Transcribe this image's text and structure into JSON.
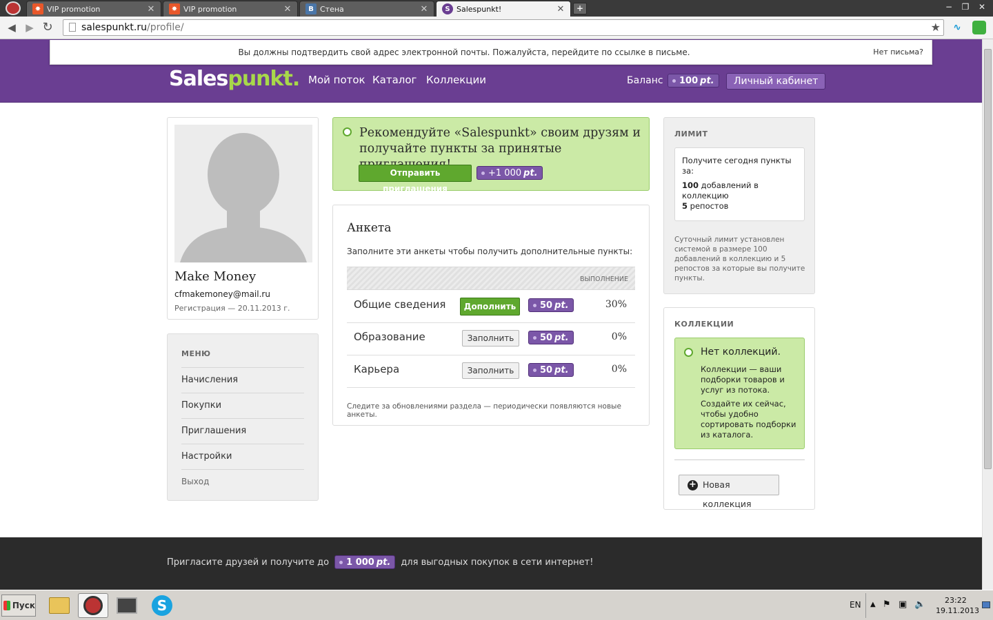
{
  "browser": {
    "tabs": [
      {
        "title": "VIP promotion",
        "favicon": "flame-icon",
        "active": false
      },
      {
        "title": "VIP promotion",
        "favicon": "flame-icon",
        "active": false
      },
      {
        "title": "Стена",
        "favicon": "vk-icon",
        "favicon_text": "В",
        "active": false
      },
      {
        "title": "Salespunkt!",
        "favicon": "salespunkt-icon",
        "active": true
      }
    ],
    "new_tab_label": "+",
    "url_host": "salespunkt.ru",
    "url_path": "/profile/",
    "win_controls": {
      "minimize": "−",
      "maximize": "❐",
      "close": "✕"
    }
  },
  "notice": {
    "message": "Вы должны подтвердить свой адрес электронной почты. Пожалуйста, перейдите по ссылке в письме.",
    "no_mail_link": "Нет письма?"
  },
  "header": {
    "logo_part1": "Sales",
    "logo_part2": "punkt.",
    "nav": [
      "Мой поток",
      "Каталог",
      "Коллекции"
    ],
    "balance_label": "Баланс",
    "balance_value": "100",
    "balance_unit": "pt.",
    "cabinet_button": "Личный кабинет"
  },
  "profile": {
    "name": "Make Money",
    "email": "cfmakemoney@mail.ru",
    "registration": "Регистрация — 20.11.2013 г."
  },
  "menu": {
    "title": "МЕНЮ",
    "items": [
      "Начисления",
      "Покупки",
      "Приглашения",
      "Настройки"
    ],
    "logout": "Выход"
  },
  "invite_banner": {
    "text": "Рекомендуйте «Salespunkt» своим друзям и получайте пункты за принятые приглашения!",
    "button": "Отправить приглашения",
    "badge_value": "+1 000",
    "badge_unit": "pt."
  },
  "survey": {
    "title": "Анкета",
    "subtitle": "Заполните эти анкеты чтобы получить дополнительные пункты:",
    "column_header": "ВЫПОЛНЕНИЕ",
    "rows": [
      {
        "name": "Общие сведения",
        "button": "Дополнить",
        "primary": true,
        "points": "50",
        "unit": "pt.",
        "progress": "30%"
      },
      {
        "name": "Образование",
        "button": "Заполнить",
        "primary": false,
        "points": "50",
        "unit": "pt.",
        "progress": "0%"
      },
      {
        "name": "Карьера",
        "button": "Заполнить",
        "primary": false,
        "points": "50",
        "unit": "pt.",
        "progress": "0%"
      }
    ],
    "footnote": "Следите за обновлениями раздела — периодически появляются новые анкеты."
  },
  "limit": {
    "title": "ЛИМИТ",
    "intro": "Получите сегодня пункты за:",
    "line1_num": "100",
    "line1_text": " добавлений в коллекцию",
    "line2_num": "5",
    "line2_text": " репостов",
    "description": "Суточный лимит установлен системой в размере 100 добавлений в коллекцию и 5 репостов за которые вы получите пункты."
  },
  "collections": {
    "title": "КОЛЛЕКЦИИ",
    "empty_title": "Нет коллекций.",
    "empty_text1": "Коллекции — ваши подборки товаров и услуг из потока.",
    "empty_text2": "Создайте их сейчас, чтобы удобно сортировать подборки из каталога.",
    "new_button": "Новая коллекция"
  },
  "footer": {
    "text_before": "Пригласите друзей и получите до",
    "badge_value": "1 000",
    "badge_unit": "pt.",
    "text_after": "для выгодных покупок в сети интернет!"
  },
  "taskbar": {
    "start_label": "Пуск",
    "lang": "EN",
    "time": "23:22",
    "date": "19.11.2013"
  },
  "colors": {
    "header_purple": "#6a3e92",
    "brand_green": "#a8d84a",
    "button_green": "#5fa82e",
    "badge_purple": "#7b57a8",
    "footer_dark": "#2b2b2b"
  }
}
